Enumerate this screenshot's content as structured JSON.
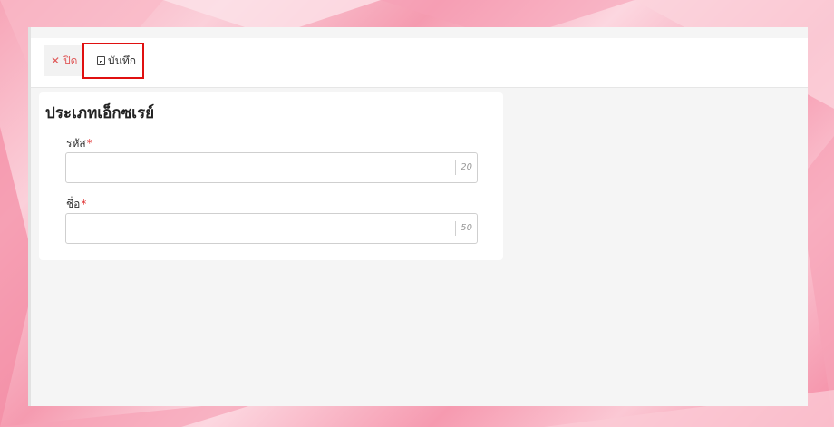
{
  "toolbar": {
    "close_label": "ปิด",
    "close_icon": "close-icon",
    "save_label": "บันทึก",
    "save_icon": "save-icon"
  },
  "form": {
    "title": "ประเภทเอ็กซเรย์",
    "fields": [
      {
        "label": "รหัส",
        "required_mark": "*",
        "value": "",
        "max_length": "20"
      },
      {
        "label": "ชื่อ",
        "required_mark": "*",
        "value": "",
        "max_length": "50"
      }
    ]
  },
  "colors": {
    "accent_close": "#e05a5a",
    "highlight_border": "#e01010",
    "required": "#e03030"
  }
}
